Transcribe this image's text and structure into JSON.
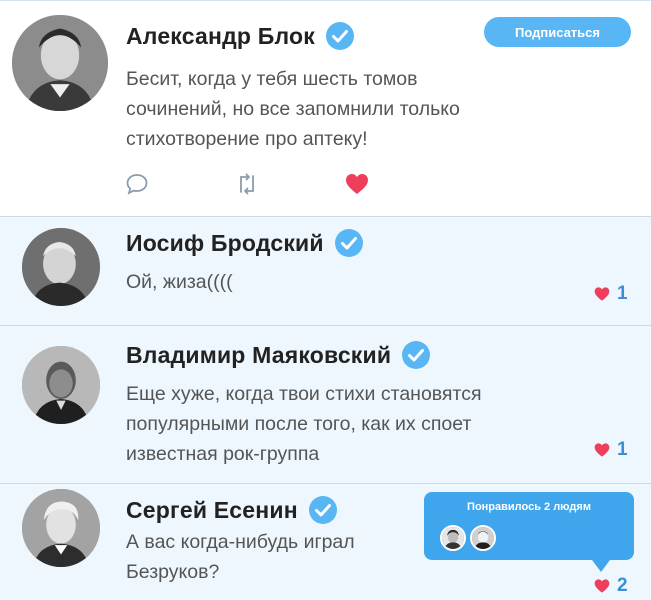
{
  "colors": {
    "accent": "#58b6f4",
    "like": "#ef3e5c",
    "count": "#3a8fd6",
    "reply_bg": "#eef7fd"
  },
  "main_post": {
    "author": "Александр Блок",
    "verified": true,
    "follow_label": "Подписаться",
    "text_lines": [
      "Бесит, когда у тебя шесть томов",
      "сочинений, но все запомнили только",
      "стихотворение про аптеку!"
    ],
    "actions": [
      "comment-icon",
      "retweet-icon",
      "heart-icon"
    ],
    "liked": true
  },
  "replies": [
    {
      "author": "Иосиф Бродский",
      "verified": true,
      "text_lines": [
        "Ой, жиза(((("
      ],
      "likes": "1"
    },
    {
      "author": "Владимир Маяковский",
      "verified": true,
      "text_lines": [
        "Еще хуже, когда твои стихи становятся",
        "популярными после того, как их споет",
        "известная рок-группа"
      ],
      "likes": "1"
    },
    {
      "author": "Сергей Есенин",
      "verified": true,
      "text_lines": [
        "А вас когда-нибудь играл",
        "Безруков?"
      ],
      "likes": "2"
    }
  ],
  "liked_by_tooltip": {
    "title": "Понравилось 2 людям",
    "avatars": [
      "avatar-pushkin",
      "avatar-lermontov"
    ]
  }
}
